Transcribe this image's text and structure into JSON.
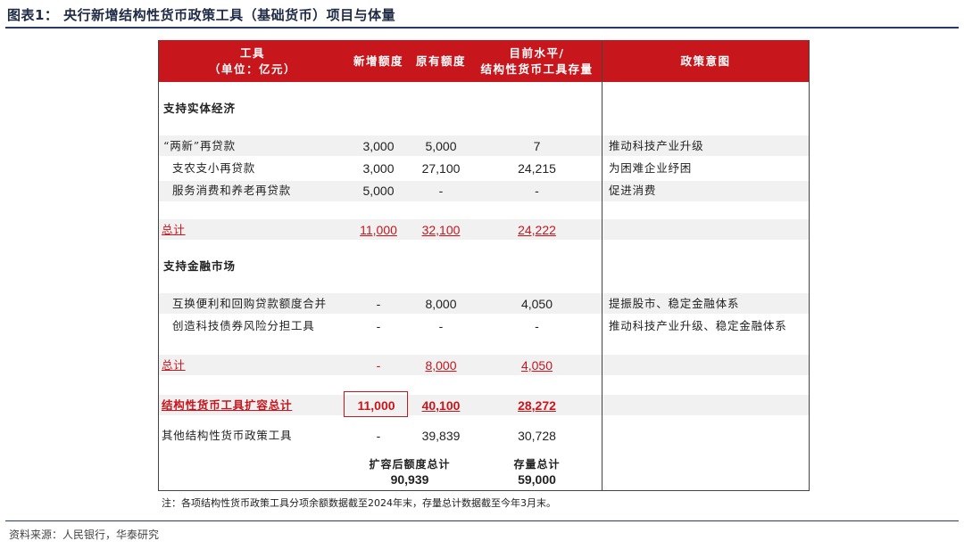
{
  "title": "图表1：  央行新增结构性货币政策工具（基础货币）项目与体量",
  "header": {
    "col1_line1": "工具",
    "col1_line2": "（单位：亿元）",
    "col2": "新增额度",
    "col3": "原有额度",
    "col4_line1": "目前水平/",
    "col4_line2": "结构性货币工具存量",
    "col5": "政策意图"
  },
  "sections": [
    {
      "title": "支持实体经济",
      "rows": [
        {
          "name": "“两新”再贷款",
          "new": "3,000",
          "old": "5,000",
          "current": "7",
          "intent": "推动科技产业升级"
        },
        {
          "name": "支农支小再贷款",
          "new": "3,000",
          "old": "27,100",
          "current": "24,215",
          "intent": "为困难企业纾困"
        },
        {
          "name": "服务消费和养老再贷款",
          "new": "5,000",
          "old": "-",
          "current": "-",
          "intent": "促进消费"
        }
      ],
      "total": {
        "label": "总计",
        "new": "11,000",
        "old": "32,100",
        "current": "24,222"
      }
    },
    {
      "title": "支持金融市场",
      "rows": [
        {
          "name": "互换便利和回购贷款额度合并",
          "new": "-",
          "old": "8,000",
          "current": "4,050",
          "intent": "提振股市、稳定金融体系"
        },
        {
          "name": "创造科技债券风险分担工具",
          "new": "-",
          "old": "-",
          "current": "-",
          "intent": "推动科技产业升级、稳定金融体系"
        }
      ],
      "total": {
        "label": "总计",
        "new": "-",
        "old": "8,000",
        "current": "4,050"
      }
    }
  ],
  "grand_total": {
    "label": "结构性货币工具扩容总计",
    "new": "11,000",
    "old": "40,100",
    "current": "28,272"
  },
  "other": {
    "label": "其他结构性货币政策工具",
    "new": "-",
    "old": "39,839",
    "current": "30,728"
  },
  "summary": {
    "expanded_label": "扩容后额度总计",
    "expanded_value": "90,939",
    "stock_label": "存量总计",
    "stock_value": "59,000"
  },
  "note": "注：各项结构性货币政策工具分项余额数据截至2024年末，存量总计数据截至今年3月末。",
  "source": "资料来源：人民银行，华泰研究",
  "colors": {
    "header_bg": "#c8161d",
    "accent_red": "#c8161d",
    "title_navy": "#1f2a44"
  }
}
